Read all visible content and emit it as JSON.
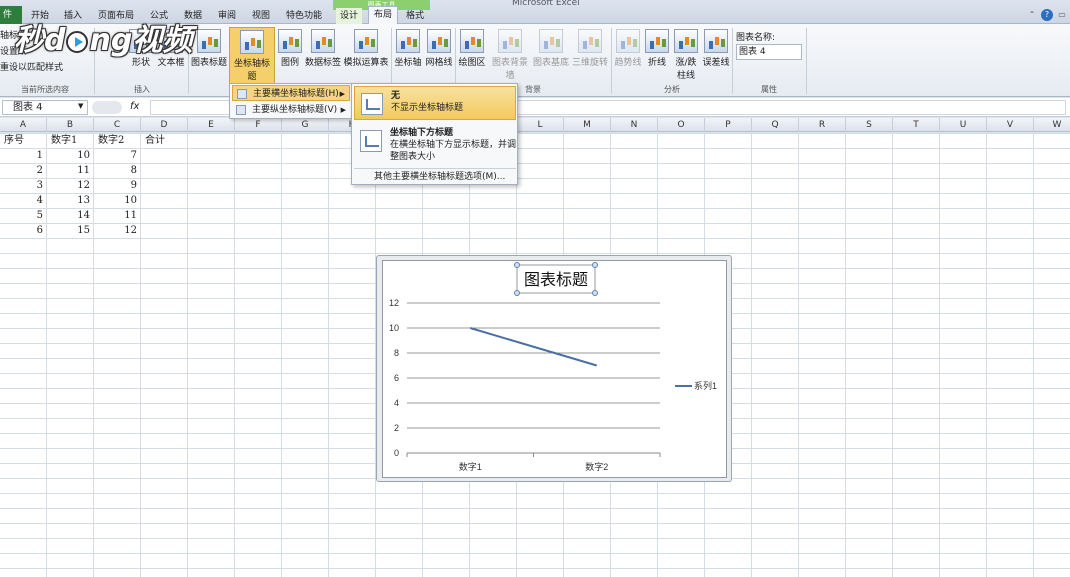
{
  "window": {
    "title": "Microsoft Excel",
    "context_tools": "图表工具"
  },
  "ribbon_tabs": [
    {
      "label": "件",
      "x": 0
    },
    {
      "label": "开始"
    },
    {
      "label": "插入"
    },
    {
      "label": "页面布局"
    },
    {
      "label": "公式"
    },
    {
      "label": "数据"
    },
    {
      "label": "审阅"
    },
    {
      "label": "视图"
    },
    {
      "label": "特色功能"
    },
    {
      "label": "设计"
    },
    {
      "label": "布局"
    },
    {
      "label": "格式"
    }
  ],
  "ribbon_left": {
    "line1": "轴标题",
    "line2": "设置所",
    "line3": "重设以匹配样式",
    "group": "当前所选内容"
  },
  "ribbon_buttons": {
    "shape": "形状",
    "textbox": "文本框",
    "insert_group": "插入",
    "chart_title": "图表标题",
    "axis_title": "坐标轴标题",
    "legend": "图例",
    "data_labels": "数据标签",
    "data_table": "模拟运算表",
    "axes": "坐标轴",
    "gridlines": "网格线",
    "plot_area": "绘图区",
    "chart_wall": "图表背景墙",
    "chart_floor": "图表基底",
    "rotation": "三维旋转",
    "background_group": "背景",
    "trendline": "趋势线",
    "lines": "折线",
    "updown_bars": "涨/跌柱线",
    "error_bars": "误差线",
    "analysis_group": "分析",
    "chart_name_label": "图表名称:",
    "chart_name_value": "图表 4",
    "properties_group": "属性"
  },
  "formula_bar": {
    "name_box": "图表 4",
    "fx": "fx",
    "formula": ""
  },
  "columns": [
    "A",
    "B",
    "C",
    "D",
    "E",
    "F",
    "G",
    "H",
    "I",
    "J",
    "K",
    "L",
    "M",
    "N",
    "O",
    "P",
    "Q",
    "R",
    "S",
    "T",
    "U",
    "V",
    "W"
  ],
  "sheet": {
    "headers": [
      "序号",
      "数字1",
      "数字2",
      "合计"
    ],
    "rows": [
      [
        "1",
        "10",
        "7"
      ],
      [
        "2",
        "11",
        "8"
      ],
      [
        "3",
        "12",
        "9"
      ],
      [
        "4",
        "13",
        "10"
      ],
      [
        "5",
        "14",
        "11"
      ],
      [
        "6",
        "15",
        "12"
      ]
    ]
  },
  "menu_axis": {
    "items": [
      "主要横坐标轴标题(H)",
      "主要纵坐标轴标题(V)"
    ]
  },
  "submenu": {
    "none_title": "无",
    "none_desc": "不显示坐标轴标题",
    "below_title": "坐标轴下方标题",
    "below_desc1": "在横坐标轴下方显示标题，并调",
    "below_desc2": "整图表大小",
    "more": "其他主要横坐标轴标题选项(M)..."
  },
  "chart_data": {
    "type": "line",
    "title": "图表标题",
    "categories": [
      "数字1",
      "数字2"
    ],
    "series": [
      {
        "name": "系列1",
        "values": [
          10,
          7
        ],
        "color": "#4a6fa5"
      }
    ],
    "ylim": [
      0,
      12
    ],
    "yticks": [
      0,
      2,
      4,
      6,
      8,
      10,
      12
    ],
    "grid": true,
    "legend": "right"
  },
  "watermark": {
    "text_left": "秒d",
    "text_right": "ng视频"
  }
}
